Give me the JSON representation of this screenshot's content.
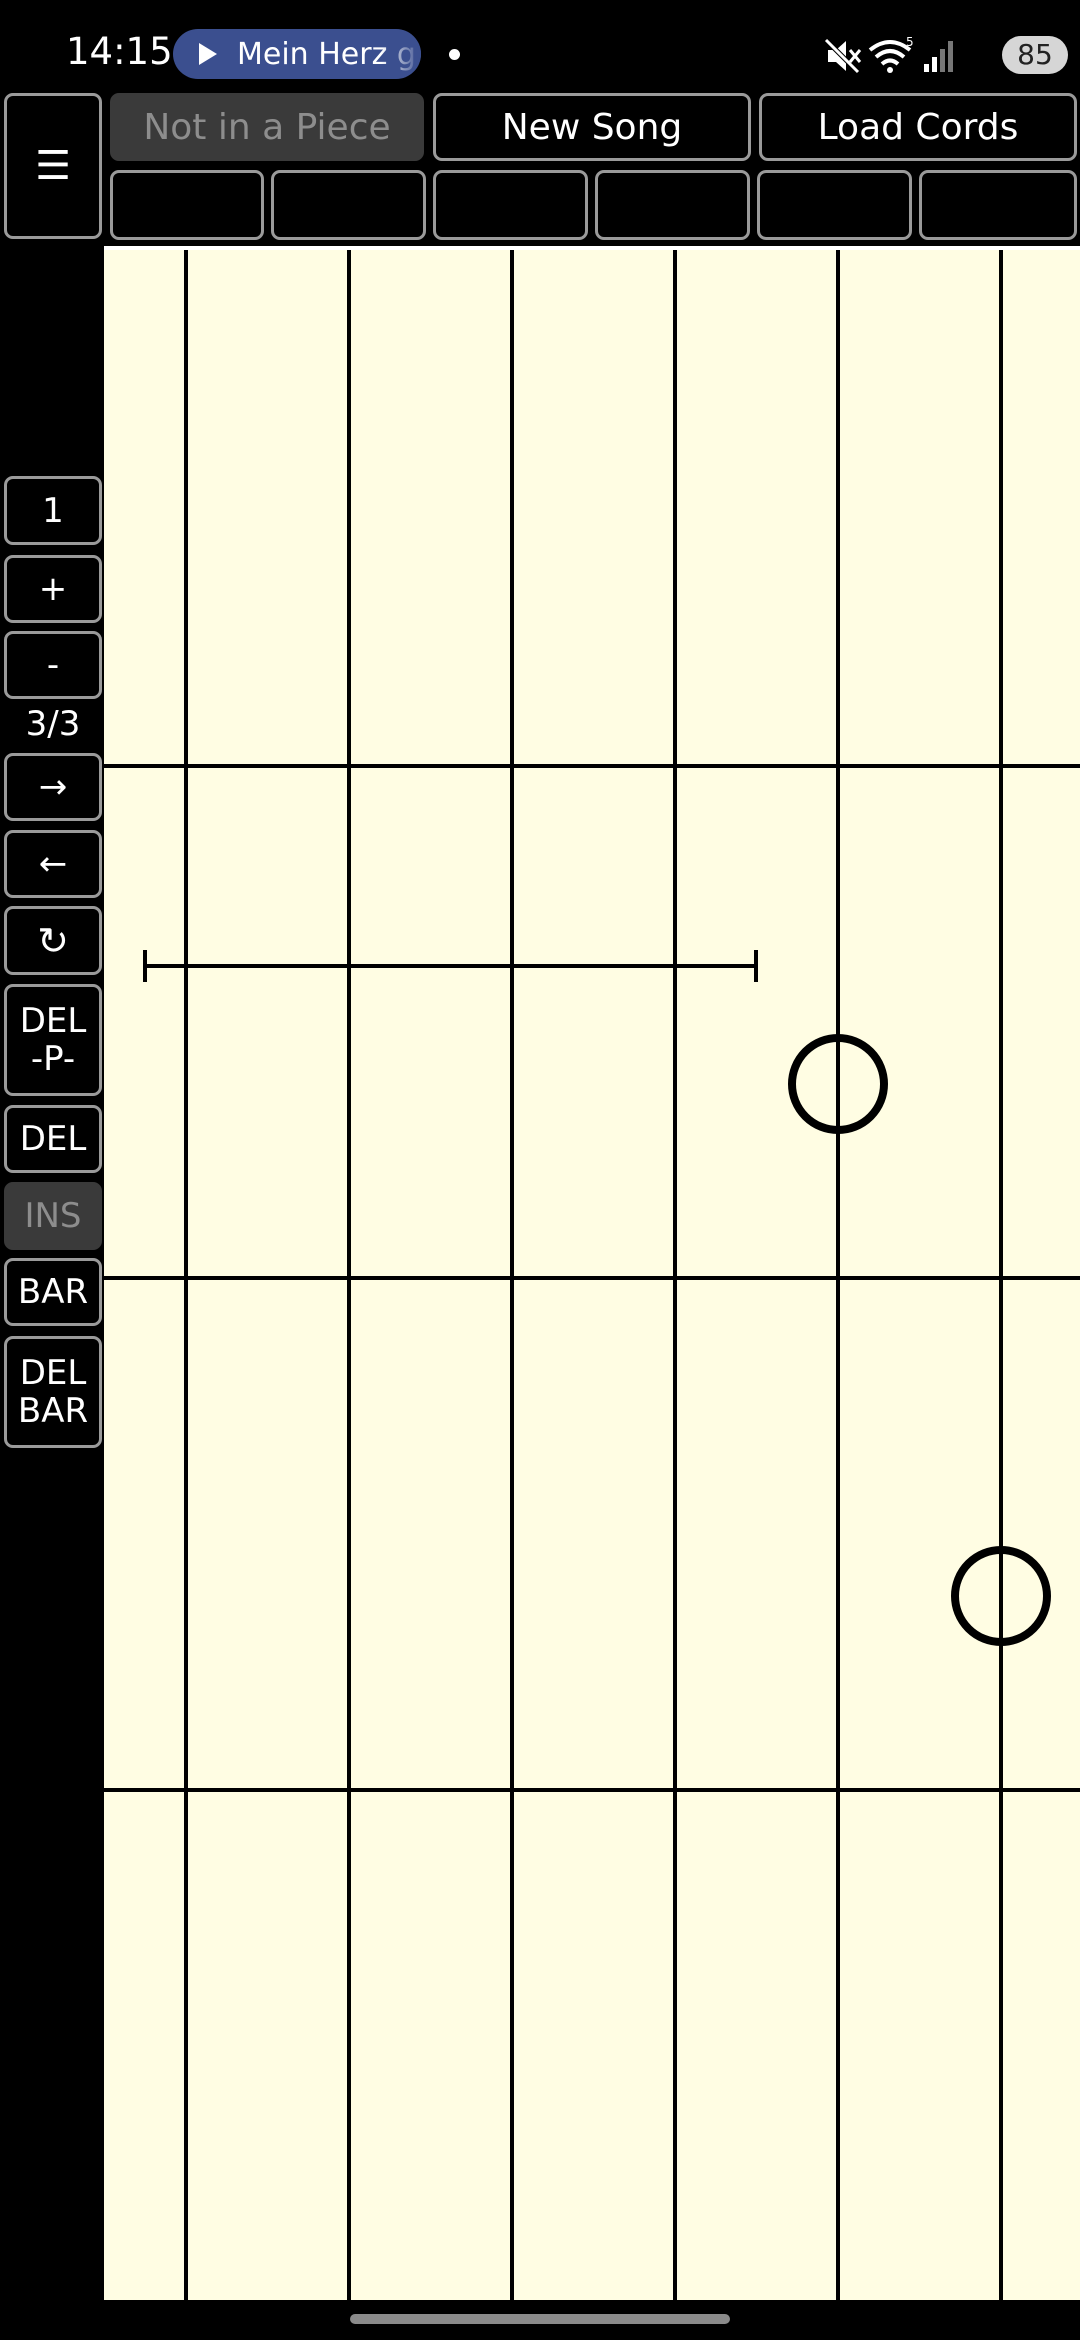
{
  "status_bar": {
    "time": "14:15",
    "media_title": "Mein Herz g",
    "battery": "85",
    "icons": [
      "mute-icon",
      "wifi-icon",
      "signal-icon",
      "battery-icon"
    ]
  },
  "menu": {
    "label": "☰"
  },
  "top_buttons": {
    "row1": [
      {
        "label": "Not in a Piece",
        "disabled": true
      },
      {
        "label": "New Song",
        "disabled": false
      },
      {
        "label": "Load Cords",
        "disabled": false
      }
    ],
    "row2": [
      "",
      "",
      "",
      "",
      "",
      ""
    ]
  },
  "side_controls": {
    "one": "1",
    "plus": "+",
    "minus": "-",
    "page_indicator": "3/3",
    "next": "→",
    "prev": "←",
    "refresh": "↻",
    "del_p_line1": "DEL",
    "del_p_line2": "-P-",
    "del": "DEL",
    "ins": "INS",
    "bar": "BAR",
    "del_bar_line1": "DEL",
    "del_bar_line2": "BAR"
  },
  "colors": {
    "board_background": "#fffde3",
    "button_border": "#9a9a9a",
    "disabled_background": "#3a3a3a",
    "media_chip": "#3b4f8f"
  }
}
